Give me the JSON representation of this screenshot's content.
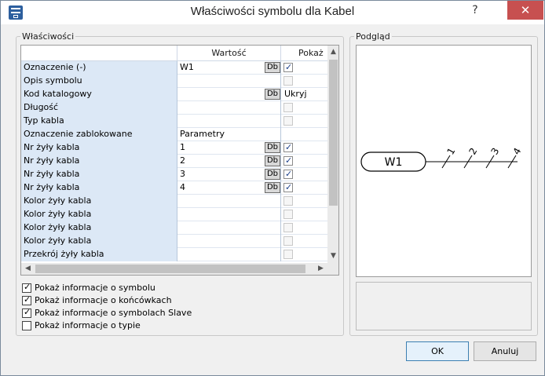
{
  "window": {
    "title": "Właściwości symbolu dla Kabel",
    "help_label": "?",
    "close_label": "✕"
  },
  "properties_group": {
    "legend": "Właściwości",
    "columns": {
      "name": "",
      "value": "Wartość",
      "show": "Pokaż"
    },
    "rows": [
      {
        "name": "Oznaczenie (-)",
        "value": "W1",
        "db": true,
        "show": "checked"
      },
      {
        "name": "Opis symbolu",
        "value": "",
        "db": false,
        "show": "disabled"
      },
      {
        "name": "Kod katalogowy",
        "value": "",
        "db": true,
        "show": "text",
        "show_text": "Ukryj"
      },
      {
        "name": "Długość",
        "value": "",
        "db": false,
        "show": "disabled"
      },
      {
        "name": "Typ kabla",
        "value": "",
        "db": false,
        "show": "disabled"
      },
      {
        "name": "Oznaczenie zablokowane",
        "value": "Parametry",
        "db": false,
        "show": "none"
      },
      {
        "name": "Nr żyły kabla",
        "value": "1",
        "db": true,
        "show": "checked"
      },
      {
        "name": "Nr żyły kabla",
        "value": "2",
        "db": true,
        "show": "checked"
      },
      {
        "name": "Nr żyły kabla",
        "value": "3",
        "db": true,
        "show": "checked"
      },
      {
        "name": "Nr żyły kabla",
        "value": "4",
        "db": true,
        "show": "checked"
      },
      {
        "name": "Kolor żyły kabla",
        "value": "",
        "db": false,
        "show": "disabled"
      },
      {
        "name": " Kolor żyły kabla",
        "value": "",
        "db": false,
        "show": "disabled"
      },
      {
        "name": " Kolor żyły kabla",
        "value": "",
        "db": false,
        "show": "disabled"
      },
      {
        "name": "Kolor żyły kabla",
        "value": "",
        "db": false,
        "show": "disabled"
      },
      {
        "name": "Przekrój żyły kabla",
        "value": "",
        "db": false,
        "show": "disabled"
      }
    ],
    "db_label": "Db"
  },
  "options": [
    {
      "label": "Pokaż informacje o symbolu",
      "checked": true
    },
    {
      "label": "Pokaż informacje o końcówkach",
      "checked": true
    },
    {
      "label": "Pokaż informacje o symbolach Slave",
      "checked": true
    },
    {
      "label": "Pokaż informacje o typie",
      "checked": false
    }
  ],
  "preview_group": {
    "legend": "Podgląd",
    "symbol_label": "W1",
    "wire_labels": [
      "1",
      "2",
      "3",
      "4"
    ]
  },
  "buttons": {
    "ok": "OK",
    "cancel": "Anuluj"
  }
}
